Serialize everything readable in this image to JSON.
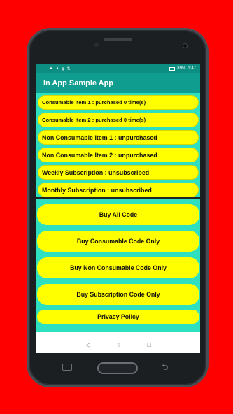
{
  "status_bar": {
    "left_icons": [
      "▲",
      "▲",
      "◈",
      "⇅"
    ],
    "battery_text": "89%",
    "time": "1:47"
  },
  "app_bar": {
    "title": "In App Sample App"
  },
  "purchase_info": [
    "Consumable Item 1 : purchased 0 time(s)",
    "Consumable Item 2 : purchased 0 time(s)",
    "Non Consumable Item 1 : unpurchased",
    "Non Consumable Item 2 : unpurchased",
    "Weekly Subscription : unsubscribed",
    "Monthly Subscription : unsubscribed"
  ],
  "buttons": [
    "Buy All Code",
    "Buy Consumable Code Only",
    "Buy Non Consumable Code Only",
    "Buy Subscription Code Only",
    "Privacy Policy"
  ],
  "nav_bar": {
    "back_icon": "◁",
    "home_icon": "○",
    "recents_icon": "□"
  },
  "colors": {
    "background": "#ff0000",
    "app_bar": "#0f9d8f",
    "content_bg": "#2ee0c0",
    "pill": "#ffff00"
  }
}
